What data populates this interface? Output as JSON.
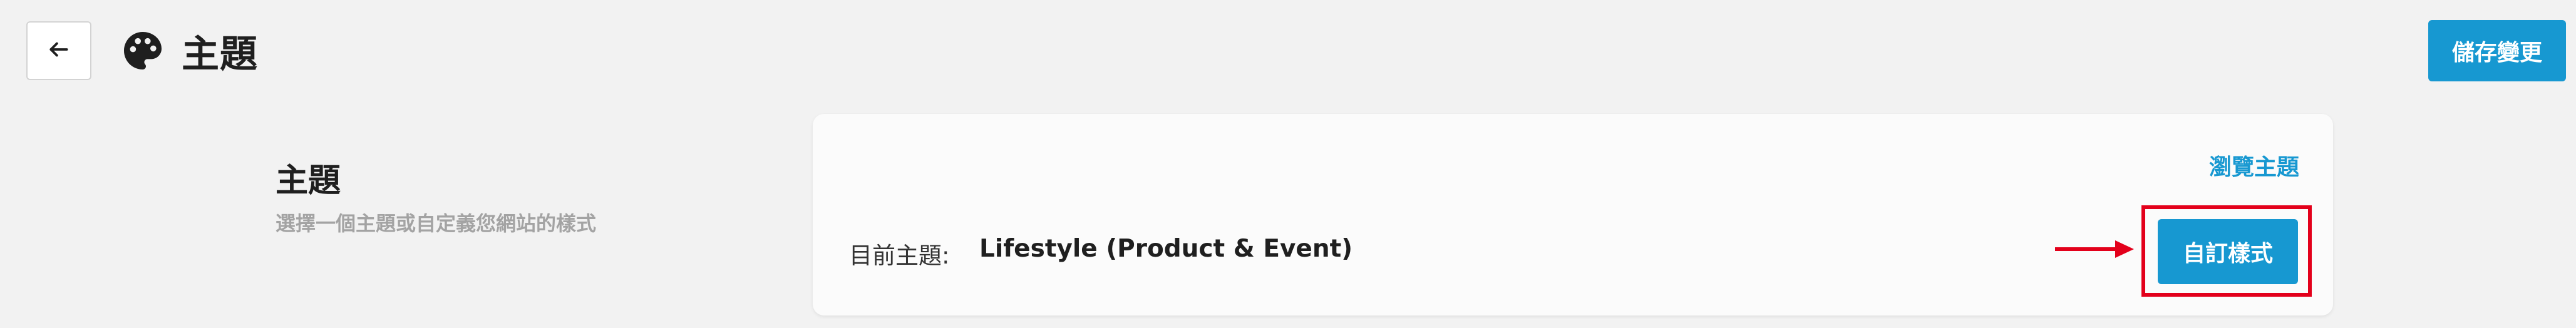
{
  "header": {
    "title": "主題",
    "back_icon": "arrow-left-icon",
    "title_icon": "palette-icon",
    "save_label": "儲存變更"
  },
  "section": {
    "title": "主題",
    "description": "選擇一個主題或自定義您網站的樣式"
  },
  "card": {
    "browse_label": "瀏覽主題",
    "current_theme_label": "目前主題:",
    "current_theme_value": "Lifestyle (Product & Event)",
    "customize_label": "自訂樣式"
  },
  "colors": {
    "accent": "#1798d1",
    "annotation": "#e3001b",
    "background": "#f2f2f2"
  }
}
